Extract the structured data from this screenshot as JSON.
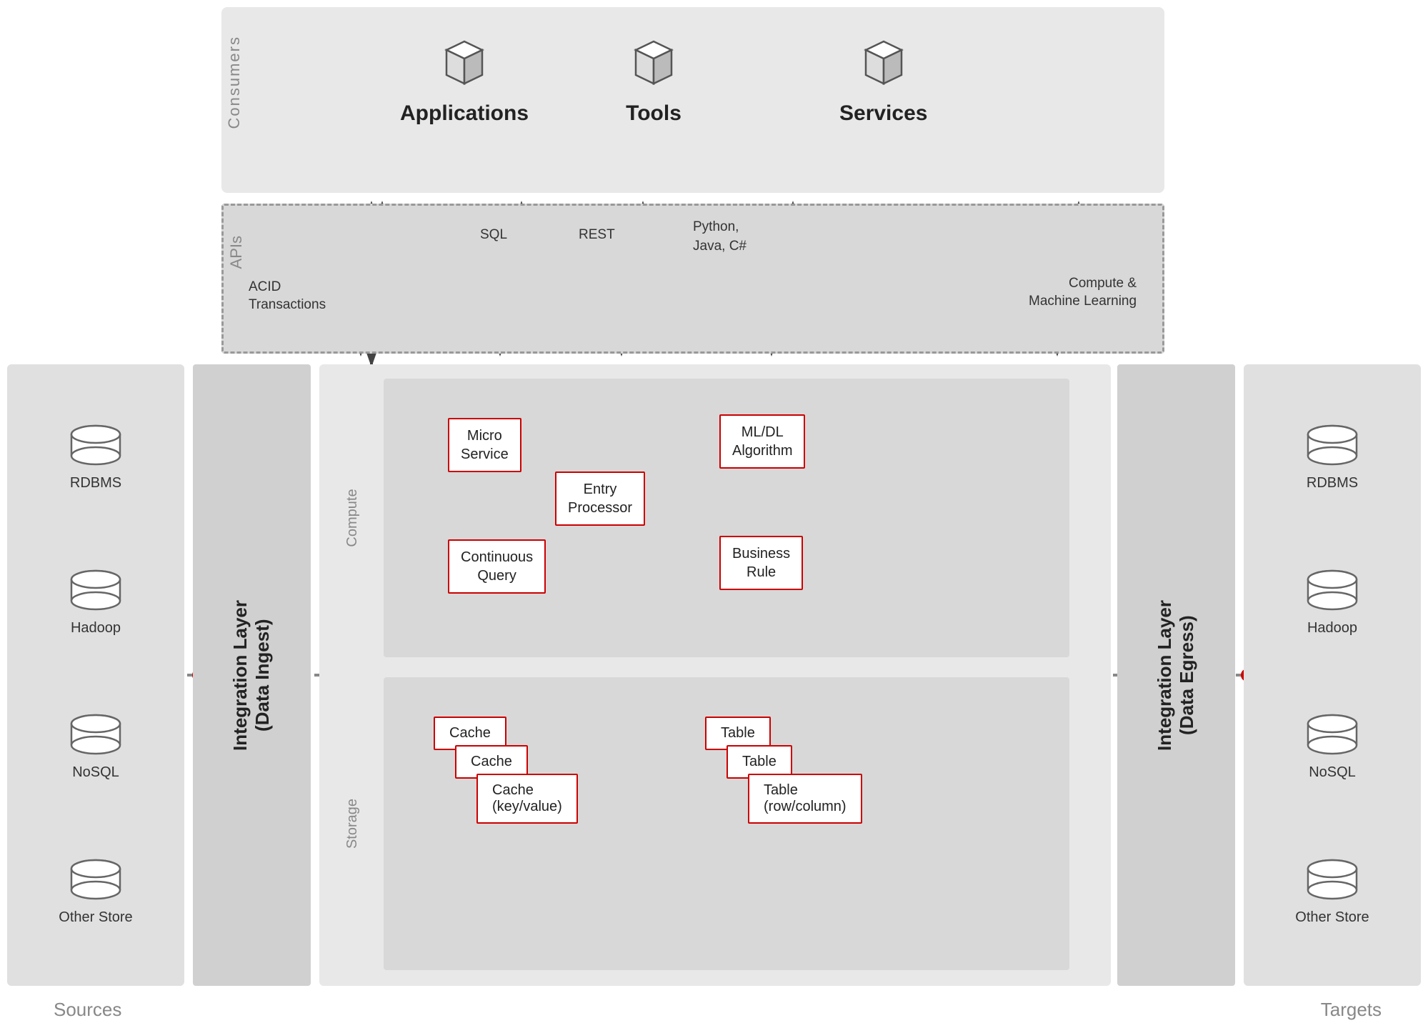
{
  "consumers": {
    "label": "Consumers",
    "applications": {
      "label": "Applications"
    },
    "tools": {
      "label": "Tools"
    },
    "services": {
      "label": "Services"
    }
  },
  "apis": {
    "label": "APIs",
    "acid_transactions": "ACID\nTransactions",
    "sql": "SQL",
    "rest": "REST",
    "python_java_csharp": "Python,\nJava, C#",
    "compute_ml": "Compute &\nMachine Learning"
  },
  "sources": {
    "label": "Sources",
    "items": [
      "RDBMS",
      "Hadoop",
      "NoSQL",
      "Other Store"
    ]
  },
  "targets": {
    "label": "Targets",
    "items": [
      "RDBMS",
      "Hadoop",
      "NoSQL",
      "Other Store"
    ]
  },
  "integration_ingest": {
    "label": "Integration Layer\n(Data Ingest)"
  },
  "integration_egress": {
    "label": "Integration Layer\n(Data Egress)"
  },
  "compute": {
    "side_label": "Compute",
    "micro_service": "Micro\nService",
    "entry_processor": "Entry\nProcessor",
    "ml_dl_algorithm": "ML/DL\nAlgorithm",
    "continuous_query": "Continuous\nQuery",
    "business_rule": "Business\nRule"
  },
  "storage": {
    "side_label": "Storage",
    "cache": "Cache",
    "cache_cache": "Cache",
    "cache_kv": "Cache\n(key/value)",
    "table": "Table",
    "table_table": "Table",
    "table_rc": "Table\n(row/column)"
  },
  "colors": {
    "accent_red": "#cc0000",
    "bg_light": "#e8e8e8",
    "bg_mid": "#d8d8d8",
    "text_dark": "#222222",
    "text_gray": "#888888",
    "arrow_gray": "#666666"
  }
}
